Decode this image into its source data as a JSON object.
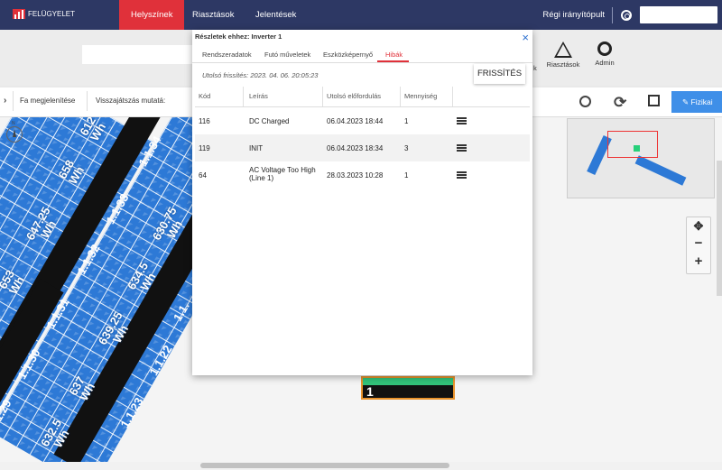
{
  "brand": {
    "name": "FELÜGYELET"
  },
  "nav": {
    "items": [
      "Helyszínek",
      "Riasztások",
      "Jelentések"
    ],
    "active": "Helyszínek"
  },
  "topright": {
    "old_dashboard": "Régi irányítópult",
    "search_placeholder": ""
  },
  "toolbar2": {
    "alarms_label": "Riasztások",
    "admin_label": "Admin",
    "partial_label": "k"
  },
  "toolbar3": {
    "tree_label": "Fa megjelenítése",
    "playback_label": "Visszajátszás mutatá:",
    "physical_label": "Fizikai"
  },
  "map": {
    "energies": [
      "612",
      "658",
      "647.25",
      "653",
      "630.75",
      "634.5",
      "639.25",
      "637",
      "632.5"
    ],
    "energy_unit": "Wh",
    "strings": [
      "1.1.34",
      "1.1.33",
      "1.1.32",
      "1.1.31",
      "1.1.30",
      "1.1.29",
      "1.1.23",
      "1.1.22",
      "1.1."
    ],
    "inverter_number": "1",
    "compass_n": "N"
  },
  "modal": {
    "title": "Részletek ehhez: Inverter 1",
    "close": "×",
    "tabs": [
      "Rendszeradatok",
      "Futó műveletek",
      "Eszközképernyő",
      "Hibák"
    ],
    "active_tab": "Hibák",
    "last_update": "Utolsó frissítés: 2023. 04. 06. 20:05:23",
    "refresh_button": "FRISSÍTÉS",
    "columns": [
      "Kód",
      "Leírás",
      "Utolsó előfordulás",
      "Mennyiség"
    ],
    "rows": [
      {
        "code": "116",
        "desc": "DC Charged",
        "last": "06.04.2023 18:44",
        "qty": "1"
      },
      {
        "code": "119",
        "desc": "INIT",
        "last": "06.04.2023 18:34",
        "qty": "3"
      },
      {
        "code": "64",
        "desc": "AC Voltage Too High (Line 1)",
        "last": "28.03.2023 10:28",
        "qty": "1"
      }
    ]
  },
  "colors": {
    "nav_bg": "#2d3864",
    "accent_red": "#e0313a",
    "panel_blue": "#2d79d6",
    "button_blue": "#3f8fe8",
    "inverter_green": "#32c37a"
  }
}
